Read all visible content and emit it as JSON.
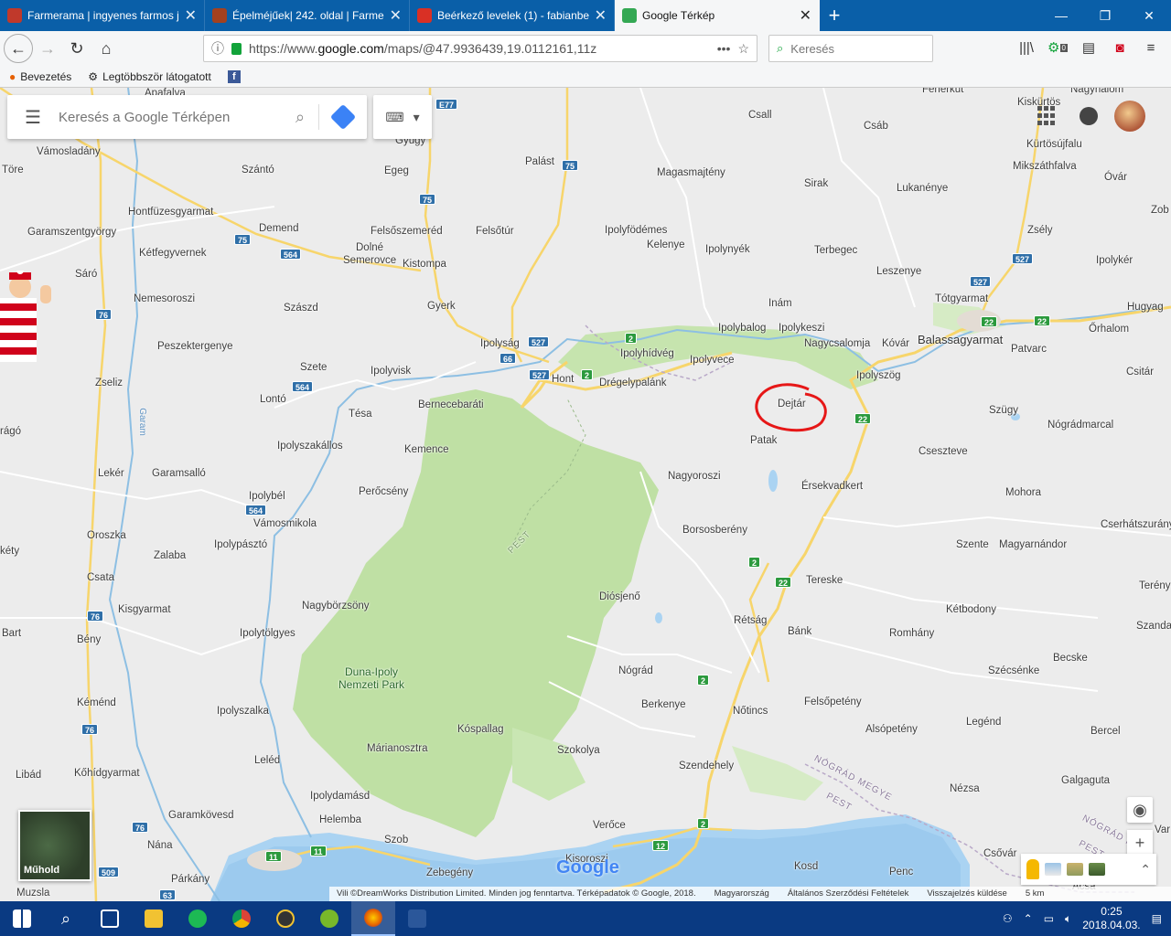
{
  "browser": {
    "tabs": [
      {
        "title": "Farmerama | ingyenes farmos j",
        "color": "#c0392b"
      },
      {
        "title": "Épelméjűek| 242. oldal | Farmer",
        "color": "#a3411f"
      },
      {
        "title": "Beérkező levelek (1) - fabianbe",
        "color": "#d93025"
      },
      {
        "title": "Google Térkép",
        "color": "#34a853",
        "active": true
      }
    ],
    "close_glyph": "✕",
    "new_tab_glyph": "+",
    "url_prefix": "https://www.",
    "url_domain": "google.com",
    "url_path": "/maps/@47.9936439,19.0112161,11z",
    "url_more": "•••",
    "search_placeholder": "Keresés",
    "bookmarks": [
      {
        "label": "Bevezetés"
      },
      {
        "label": "Legtöbbször látogatott"
      }
    ],
    "notif_badge": "0"
  },
  "maps": {
    "search_placeholder": "Keresés a Google Térképen",
    "satellite_label": "Műhold",
    "zoom_in": "+",
    "zoom_out": "−",
    "logo": "Google",
    "attribution": [
      "Vili ©DreamWorks Distribution Limited. Minden jog fenntartva. Térképadatok © Google, 2018.",
      "Magyarország",
      "Általános Szerződési Feltételek",
      "Visszajelzés küldése",
      "5 km"
    ],
    "places": [
      {
        "n": "Apafalva"
      },
      {
        "n": "Fenerkut"
      },
      {
        "n": "Nagyhalom"
      },
      {
        "n": "Kiskürtös"
      },
      {
        "n": "Csall"
      },
      {
        "n": "Csáb"
      },
      {
        "n": "Vámosladány"
      },
      {
        "n": "Gyügy"
      },
      {
        "n": "Palást"
      },
      {
        "n": "Kürtösújfalu"
      },
      {
        "n": "Mikszáthfalva"
      },
      {
        "n": "Óvár"
      },
      {
        "n": "Töre"
      },
      {
        "n": "Szántó"
      },
      {
        "n": "Egeg"
      },
      {
        "n": "Magasmajtény"
      },
      {
        "n": "Sirak"
      },
      {
        "n": "Lukanénye"
      },
      {
        "n": "Zsély"
      },
      {
        "n": "Zob"
      },
      {
        "n": "Hontfüzesgyarmat"
      },
      {
        "n": "Demend"
      },
      {
        "n": "Felsőszemeréd"
      },
      {
        "n": "Felsőtúr"
      },
      {
        "n": "Ipolyfödémes"
      },
      {
        "n": "Kelenye"
      },
      {
        "n": "Garamszentgyörgy"
      },
      {
        "n": "Kétfegyvernek"
      },
      {
        "n": "Dolné"
      },
      {
        "n": "Semerovce"
      },
      {
        "n": "Kistompa"
      },
      {
        "n": "Ipolynyék"
      },
      {
        "n": "Terbegec"
      },
      {
        "n": "Leszenye"
      },
      {
        "n": "Ipolykér"
      },
      {
        "n": "Sáró"
      },
      {
        "n": "Nemesoroszi"
      },
      {
        "n": "Szászd"
      },
      {
        "n": "Gyerk"
      },
      {
        "n": "Inám"
      },
      {
        "n": "Tótgyarmat"
      },
      {
        "n": "Hugyag"
      },
      {
        "n": "Peszektergenye"
      },
      {
        "n": "Ipolyság"
      },
      {
        "n": "Ipolybalog"
      },
      {
        "n": "Ipolykeszi"
      },
      {
        "n": "Nagycsalomja"
      },
      {
        "n": "Kóvár"
      },
      {
        "n": "Balassagyarmat"
      },
      {
        "n": "Patvarc"
      },
      {
        "n": "Őrhalom"
      },
      {
        "n": "Ipolyhídvég"
      },
      {
        "n": "Ipolyvece"
      },
      {
        "n": "Szete"
      },
      {
        "n": "Ipolyvisk"
      },
      {
        "n": "Hont"
      },
      {
        "n": "Drégelypalánk"
      },
      {
        "n": "Ipolyszög"
      },
      {
        "n": "Csitár"
      },
      {
        "n": "Zseliz"
      },
      {
        "n": "Lontó"
      },
      {
        "n": "Bernecebaráti"
      },
      {
        "n": "Dejtár"
      },
      {
        "n": "Szügy"
      },
      {
        "n": "Nógrádmarcal"
      },
      {
        "n": "Tésa"
      },
      {
        "n": "Patak"
      },
      {
        "n": "Ipolyszakállos"
      },
      {
        "n": "Kemence"
      },
      {
        "n": "Cseszteve"
      },
      {
        "n": "rágó"
      },
      {
        "n": "Lekér"
      },
      {
        "n": "Garamsalló"
      },
      {
        "n": "Nagyoroszi"
      },
      {
        "n": "Érsekvadkert"
      },
      {
        "n": "Perőcsény"
      },
      {
        "n": "Mohora"
      },
      {
        "n": "Ipolybél"
      },
      {
        "n": "Vámosmikola"
      },
      {
        "n": "Borsosberény"
      },
      {
        "n": "Cserháts­zurány"
      },
      {
        "n": "Oroszka"
      },
      {
        "n": "Szente"
      },
      {
        "n": "Magyarnándor"
      },
      {
        "n": "kéty"
      },
      {
        "n": "Ipolypásztó"
      },
      {
        "n": "Zalaba"
      },
      {
        "n": "Csata"
      },
      {
        "n": "Tereske"
      },
      {
        "n": "Terény"
      },
      {
        "n": "Kisgyarmat"
      },
      {
        "n": "Nagybörzsöny"
      },
      {
        "n": "Diósjenő"
      },
      {
        "n": "Kétbodony"
      },
      {
        "n": "Bart"
      },
      {
        "n": "Ipolytölgyes"
      },
      {
        "n": "Rétság"
      },
      {
        "n": "Bánk"
      },
      {
        "n": "Romhány"
      },
      {
        "n": "Szanda"
      },
      {
        "n": "Bény"
      },
      {
        "n": "Becske"
      },
      {
        "n": "Nógrád"
      },
      {
        "n": "Szécsénke"
      },
      {
        "n": "Kéménd"
      },
      {
        "n": "Ipolyszalka"
      },
      {
        "n": "Berkenye"
      },
      {
        "n": "Felsőpetény"
      },
      {
        "n": "Nőtincs"
      },
      {
        "n": "Legénd"
      },
      {
        "n": "Kóspallag"
      },
      {
        "n": "Alsópetény"
      },
      {
        "n": "Bercel"
      },
      {
        "n": "Márianosztra"
      },
      {
        "n": "Szokolya"
      },
      {
        "n": "Kőhídgyarmat"
      },
      {
        "n": "Leléd"
      },
      {
        "n": "Libád"
      },
      {
        "n": "Szendehely"
      },
      {
        "n": "Galgaguta"
      },
      {
        "n": "Ipolydamásd"
      },
      {
        "n": "Nézsa"
      },
      {
        "n": "Garamkövesd"
      },
      {
        "n": "Helemba"
      },
      {
        "n": "Szob"
      },
      {
        "n": "Verőce"
      },
      {
        "n": "Csővár"
      },
      {
        "n": "Nána"
      },
      {
        "n": "Kisoroszi"
      },
      {
        "n": "Zebegény"
      },
      {
        "n": "Kosd"
      },
      {
        "n": "Penc"
      },
      {
        "n": "Párkány"
      },
      {
        "n": "Muzsla"
      },
      {
        "n": "Acsa"
      },
      {
        "n": "Var"
      }
    ],
    "park": "Duna-Ipoly\nNemzeti Park",
    "county": "NÓGRÁD MEGYE",
    "county2": "PEST",
    "county3": "PEST",
    "county4": "NÓGRÁD M",
    "county5": "PEST",
    "shields": [
      {
        "n": "E77"
      },
      {
        "n": "75"
      },
      {
        "n": "75"
      },
      {
        "n": "75"
      },
      {
        "n": "564"
      },
      {
        "n": "76"
      },
      {
        "n": "564"
      },
      {
        "n": "66"
      },
      {
        "n": "527"
      },
      {
        "n": "527"
      },
      {
        "n": "2",
        "g": true
      },
      {
        "n": "2",
        "g": true
      },
      {
        "n": "527"
      },
      {
        "n": "527"
      },
      {
        "n": "22",
        "g": true
      },
      {
        "n": "22",
        "g": true
      },
      {
        "n": "22",
        "g": true
      },
      {
        "n": "564"
      },
      {
        "n": "2",
        "g": true
      },
      {
        "n": "22",
        "g": true
      },
      {
        "n": "76"
      },
      {
        "n": "2",
        "g": true
      },
      {
        "n": "76"
      },
      {
        "n": "76"
      },
      {
        "n": "2",
        "g": true
      },
      {
        "n": "12",
        "g": true
      },
      {
        "n": "11",
        "g": true
      },
      {
        "n": "11",
        "g": true
      },
      {
        "n": "509"
      },
      {
        "n": "63"
      }
    ],
    "river_label": "Garam"
  },
  "taskbar": {
    "time": "0:25",
    "date": "2018.04.03."
  }
}
